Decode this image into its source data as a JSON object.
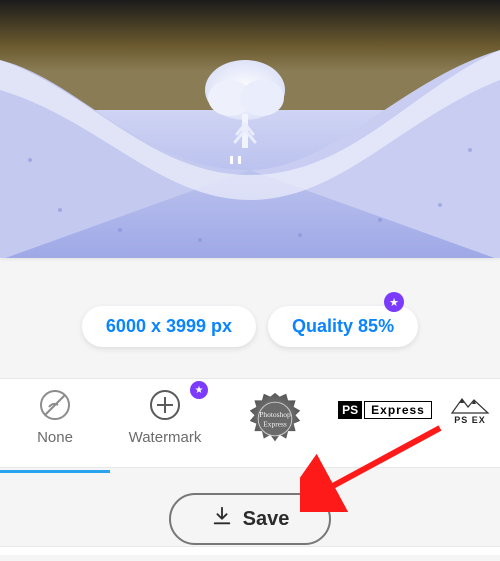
{
  "pills": {
    "dimensions": "6000 x 3999 px",
    "quality": "Quality 85%"
  },
  "strip": {
    "none": "None",
    "watermark": "Watermark",
    "seal_text_top": "Photoshop",
    "seal_text_bottom": "Express",
    "ps_badge_prefix": "PS",
    "ps_badge_text": "Express",
    "ps_badge2_prefix": "PS EX"
  },
  "actions": {
    "save": "Save"
  },
  "icons": {
    "star": "★",
    "none": "no-smoking-style-circle",
    "plus": "+",
    "download": "↓"
  },
  "colors": {
    "accent": "#2aa3ef",
    "link": "#0a84ff",
    "premium": "#7a3bff"
  }
}
